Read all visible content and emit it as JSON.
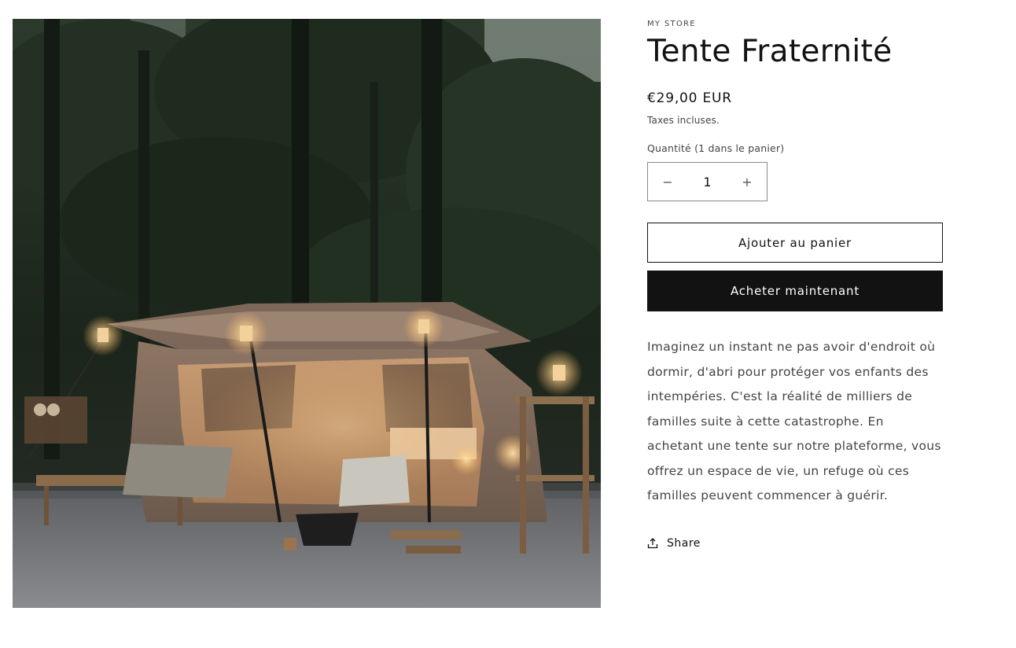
{
  "product": {
    "vendor": "MY STORE",
    "title": "Tente Fraternité",
    "price": "€29,00 EUR",
    "tax_note": "Taxes incluses.",
    "quantity_label": "Quantité (1 dans le panier)",
    "quantity_value": "1",
    "decrease_symbol": "−",
    "increase_symbol": "+",
    "add_to_cart_label": "Ajouter au panier",
    "buy_now_label": "Acheter maintenant",
    "description": "Imaginez un instant ne pas avoir d'endroit où dormir, d'abri pour protéger vos enfants des intempéries. C'est la réalité de milliers de familles suite à cette catastrophe. En achetant une tente sur notre plateforme, vous offrez un espace de vie, un refuge où ces familles peuvent commencer à guérir.",
    "share_label": "Share"
  },
  "icons": {
    "share": "share-icon",
    "minus": "minus-icon",
    "plus": "plus-icon"
  },
  "colors": {
    "primary": "#121212",
    "border": "#8a8a8a",
    "muted_text": "#444444"
  }
}
